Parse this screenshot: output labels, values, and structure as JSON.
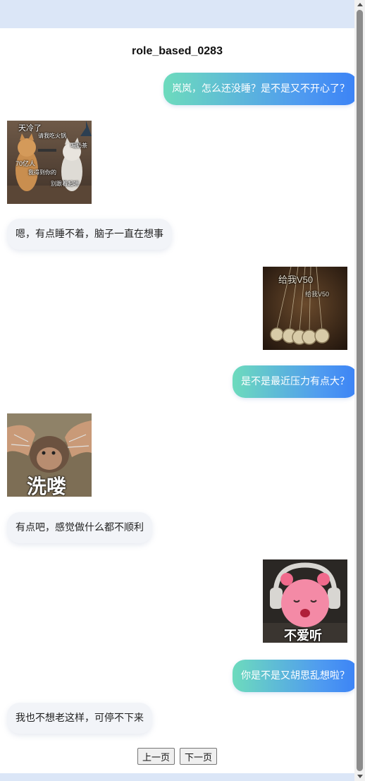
{
  "conversation": {
    "title": "role_based_0283",
    "messages": [
      {
        "side": "right",
        "type": "text",
        "text": "岚岚，怎么还没睡？是不是又不开心了？"
      },
      {
        "side": "left",
        "type": "sticker",
        "sticker": "cats-gun-meme",
        "captions": [
          "天冷了",
          "请我吃火锅",
          "喝奶茶",
          "70亿人",
          "我得到你的",
          "别跟着起哄"
        ]
      },
      {
        "side": "left",
        "type": "text",
        "text": "嗯，有点睡不着，脑子一直在想事"
      },
      {
        "side": "right",
        "type": "sticker",
        "sticker": "pendulum-meme",
        "captions": [
          "给我V50",
          "给我V50"
        ]
      },
      {
        "side": "right",
        "type": "text",
        "text": "是不是最近压力有点大？"
      },
      {
        "side": "left",
        "type": "sticker",
        "sticker": "monkey-wash-meme",
        "captions": [
          "洗喽"
        ]
      },
      {
        "side": "left",
        "type": "text",
        "text": "有点吧，感觉做什么都不顺利"
      },
      {
        "side": "right",
        "type": "sticker",
        "sticker": "pink-bear-headphones-meme",
        "captions": [
          "不爱听"
        ]
      },
      {
        "side": "right",
        "type": "text",
        "text": "你是不是又胡思乱想啦？"
      },
      {
        "side": "left",
        "type": "text",
        "text": "我也不想老这样，可停不下来"
      }
    ]
  },
  "pagination": {
    "prev_label": "上一页",
    "next_label": "下一页"
  },
  "colors": {
    "bubble_gradient_start": "#6ddbbd",
    "bubble_gradient_end": "#3b82f6",
    "left_bubble_bg": "#f2f4f8",
    "band": "#dbe6f7"
  }
}
